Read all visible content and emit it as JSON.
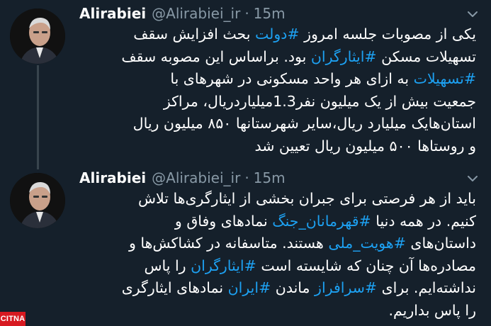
{
  "tweets": [
    {
      "name": "Alirabiei",
      "handle": "@Alirabiei_ir",
      "separator": "·",
      "time": "15m",
      "lines": [
        [
          {
            "t": "یکی از مصوبات جلسه امروز "
          },
          {
            "t": "#دولت",
            "tag": true
          },
          {
            "t": " بحث افزایش سقف"
          }
        ],
        [
          {
            "t": "تسهیلات مسکن "
          },
          {
            "t": "#ایثارگران",
            "tag": true
          },
          {
            "t": " بود. براساس این مصوبه سقف"
          }
        ],
        [
          {
            "t": "#تسهیلات",
            "tag": true
          },
          {
            "t": " به ازای هر واحد مسکونی در شهرهای با"
          }
        ],
        [
          {
            "t": "جمعیت بیش از یک میلیون نفر1.3میلیاردریال، مراکز"
          }
        ],
        [
          {
            "t": "استان‌هایک میلیارد ریال،سایر شهرستانها ۸۵۰ میلیون ریال"
          }
        ],
        [
          {
            "t": "و روستاها ۵۰۰ میلیون ریال تعیین شد"
          }
        ]
      ]
    },
    {
      "name": "Alirabiei",
      "handle": "@Alirabiei_ir",
      "separator": "·",
      "time": "15m",
      "lines": [
        [
          {
            "t": "باید از هر فرصتی برای جبران بخشی از ایثارگری‌ها تلاش"
          }
        ],
        [
          {
            "t": "کنیم. در همه دنیا "
          },
          {
            "t": "#قهرمانان_جنگ",
            "tag": true
          },
          {
            "t": " نمادهای وفاق و"
          }
        ],
        [
          {
            "t": "داستان‌های "
          },
          {
            "t": "#هویت_ملی",
            "tag": true
          },
          {
            "t": " هستند. متاسفانه در کشاکش‌ها و"
          }
        ],
        [
          {
            "t": "مصادره‌ها آن چنان که شایسته است "
          },
          {
            "t": "#ایثارگران",
            "tag": true
          },
          {
            "t": " را پاس"
          }
        ],
        [
          {
            "t": "نداشته‌ایم. برای "
          },
          {
            "t": "#سرافراز",
            "tag": true
          },
          {
            "t": " ماندن "
          },
          {
            "t": "#ایران",
            "tag": true
          },
          {
            "t": " نمادهای ایثارگری"
          }
        ],
        [
          {
            "t": "را پاس بداریم."
          }
        ]
      ]
    }
  ],
  "watermark": "CITNA",
  "colors": {
    "background": "#15202b",
    "text": "#ffffff",
    "secondary": "#8899a6",
    "hashtag": "#1da1f2",
    "thread_line": "#38444d",
    "watermark_bg": "#d71920"
  },
  "icons": {
    "avatar": "profile-photo",
    "menu": "chevron-down-icon"
  }
}
